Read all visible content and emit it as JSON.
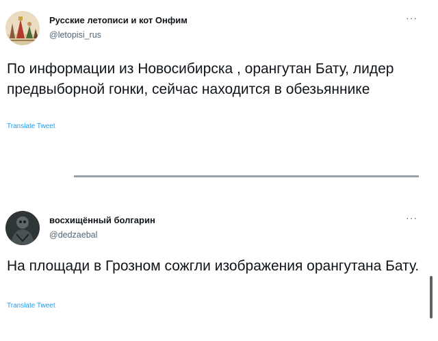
{
  "tweets": [
    {
      "author_name": "Русские летописи и кот Онфим",
      "handle": "@letopisi_rus",
      "text": "По информации из Новосибирска , орангутан Бату, лидер предвыборной гонки, сейчас находится в обезьяннике",
      "translate_label": "Translate Tweet",
      "more_label": "···",
      "avatar_icon": "manuscript-illustration-avatar"
    },
    {
      "author_name": "восхищённый болгарин",
      "handle": "@dedzaebal",
      "text": "На площади в Грозном сожгли изображения орангутана Бату.",
      "translate_label": "Translate Tweet",
      "more_label": "···",
      "avatar_icon": "dark-figure-avatar"
    }
  ],
  "colors": {
    "link": "#1d9bf0",
    "secondary_text": "#536471",
    "primary_text": "#0f1419",
    "divider": "#9aa0a6"
  }
}
